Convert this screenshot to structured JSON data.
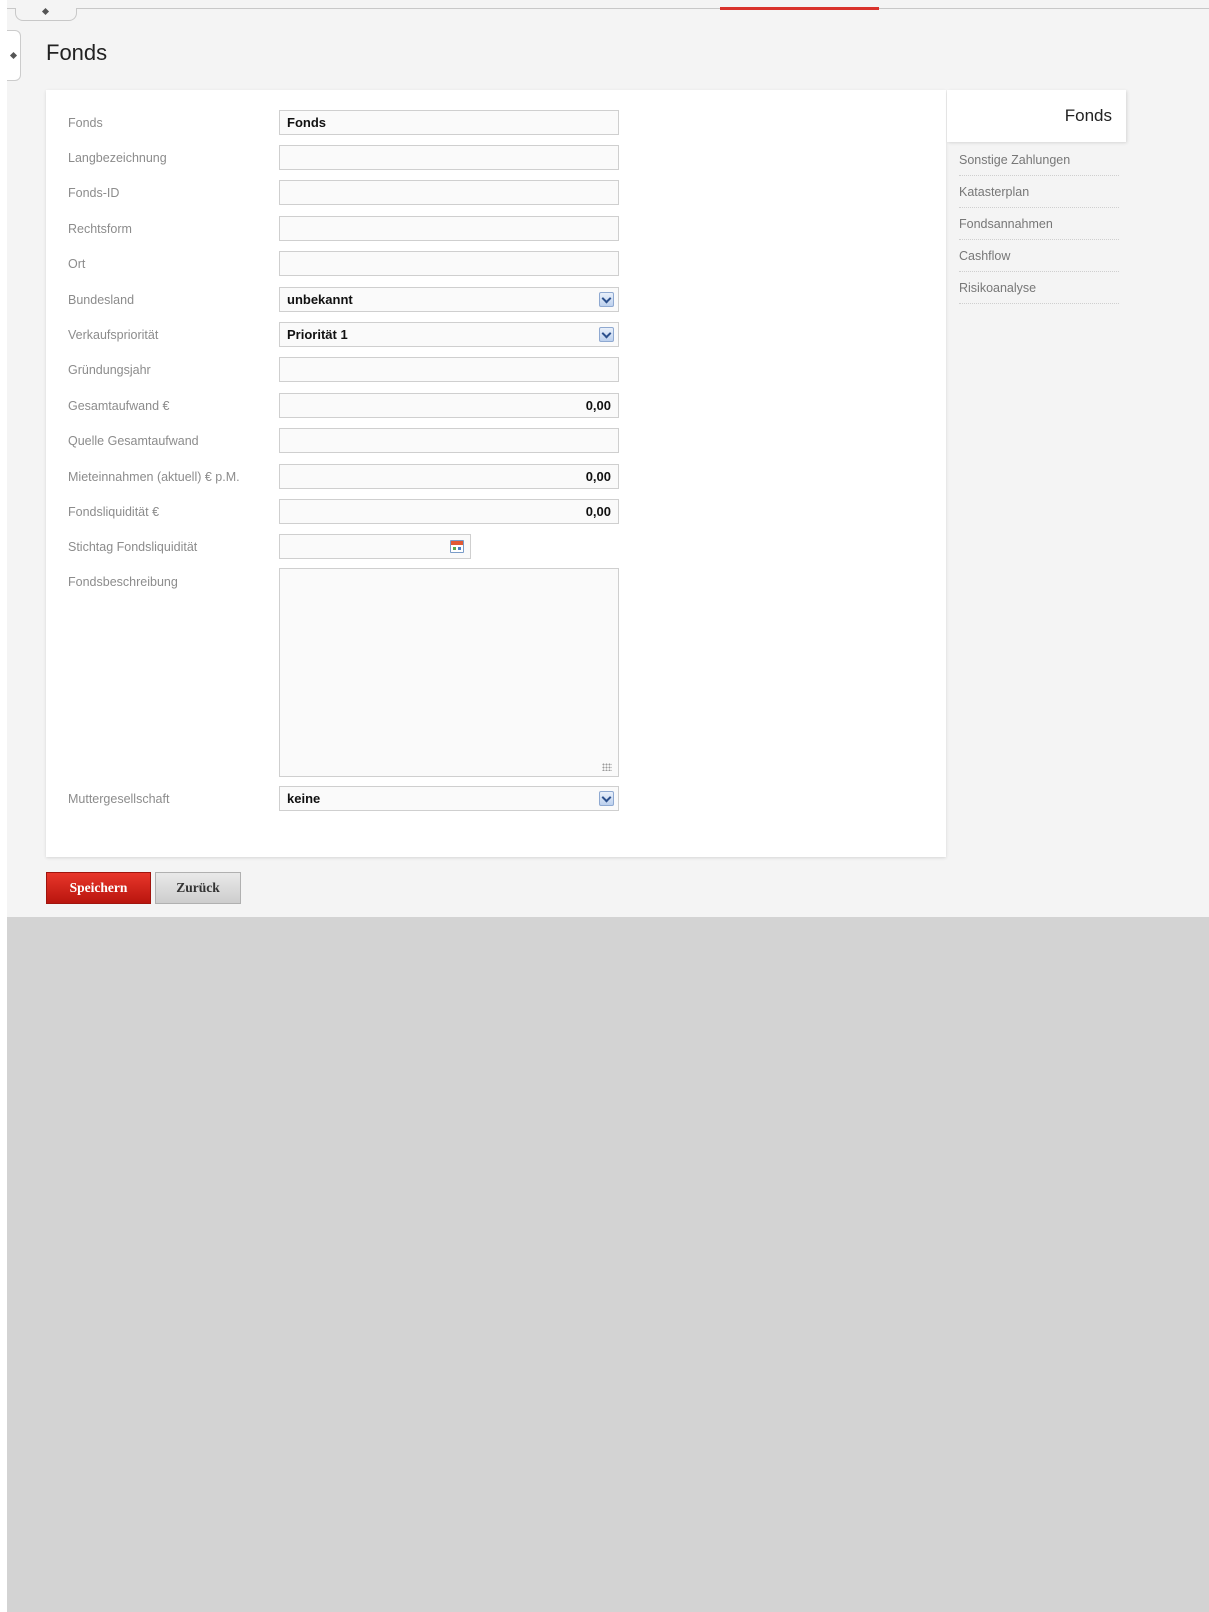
{
  "page": {
    "title": "Fonds"
  },
  "form": {
    "fields": [
      {
        "label": "Fonds",
        "value": "Fonds"
      },
      {
        "label": "Langbezeichnung",
        "value": ""
      },
      {
        "label": "Fonds-ID",
        "value": ""
      },
      {
        "label": "Rechtsform",
        "value": ""
      },
      {
        "label": "Ort",
        "value": ""
      },
      {
        "label": "Bundesland",
        "value": "unbekannt"
      },
      {
        "label": "Verkaufspriorität",
        "value": "Priorität 1"
      },
      {
        "label": "Gründungsjahr",
        "value": ""
      },
      {
        "label": "Gesamtaufwand €",
        "value": "0,00"
      },
      {
        "label": "Quelle Gesamtaufwand",
        "value": ""
      },
      {
        "label": "Mieteinnahmen (aktuell) € p.M.",
        "value": "0,00"
      },
      {
        "label": "Fondsliquidität €",
        "value": "0,00"
      },
      {
        "label": "Stichtag Fondsliquidität",
        "value": ""
      },
      {
        "label": "Fondsbeschreibung",
        "value": ""
      },
      {
        "label": "Muttergesellschaft",
        "value": "keine"
      }
    ]
  },
  "side_nav": {
    "active": "Fonds",
    "items": [
      {
        "label": "Sonstige Zahlungen"
      },
      {
        "label": "Katasterplan"
      },
      {
        "label": "Fondsannahmen"
      },
      {
        "label": "Cashflow"
      },
      {
        "label": "Risikoanalyse"
      }
    ]
  },
  "buttons": {
    "save": "Speichern",
    "back": "Zurück"
  },
  "icons": {
    "select_arrow": "chevron-down-icon",
    "date_picker": "calendar-icon",
    "resize": "resize-grip-icon"
  },
  "colors": {
    "accent": "#d9322b",
    "background": "#f4f4f4",
    "panel": "#ffffff",
    "outer": "#d3d3d3"
  }
}
